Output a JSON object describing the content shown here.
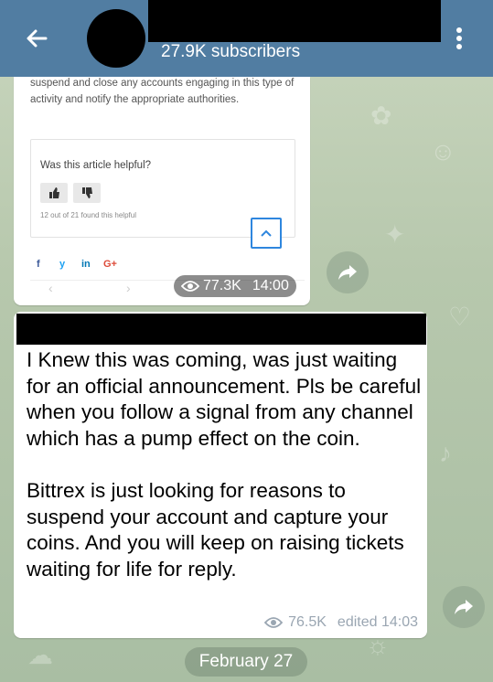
{
  "header": {
    "subscribers": "27.9K subscribers"
  },
  "post1": {
    "screenshot_text": "suspend and close any accounts engaging in this type of activity and notify the appropriate authorities.",
    "helpful_question": "Was this article helpful?",
    "helpful_count": "12 out of 21 found this helpful",
    "social": [
      "f",
      "y",
      "in",
      "G+"
    ],
    "views": "77.3K",
    "time": "14:00"
  },
  "post2": {
    "text": "I Knew this was coming, was just waiting for an official announcement. Pls be careful when you follow a signal from any channel which has a pump effect on the coin.\n\nBittrex is just looking for reasons to suspend your account and capture your coins. And you will keep on raising tickets waiting for life for reply.",
    "views": "76.5K",
    "edited_time": "edited 14:03"
  },
  "date_separator": "February 27",
  "colors": {
    "header": "#517da2",
    "bubble": "#ffffff",
    "meta": "#9aa6b2",
    "chat_background": "#b9c9b0"
  }
}
